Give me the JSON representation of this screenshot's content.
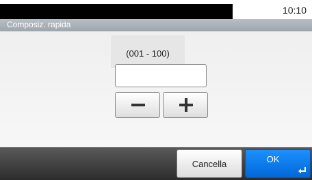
{
  "status": {
    "time": "10:10"
  },
  "header": {
    "title": "Composiz. rapida"
  },
  "dial": {
    "range_label": "(001 - 100)",
    "value": "",
    "decrement_icon": "minus-icon",
    "increment_icon": "plus-icon"
  },
  "footer": {
    "cancel_label": "Cancella",
    "ok_label": "OK",
    "ok_icon": "enter-icon"
  },
  "colors": {
    "accent": "#1e90ff",
    "title_bar": "#a8afb6",
    "footer": "#3c3c3c"
  }
}
